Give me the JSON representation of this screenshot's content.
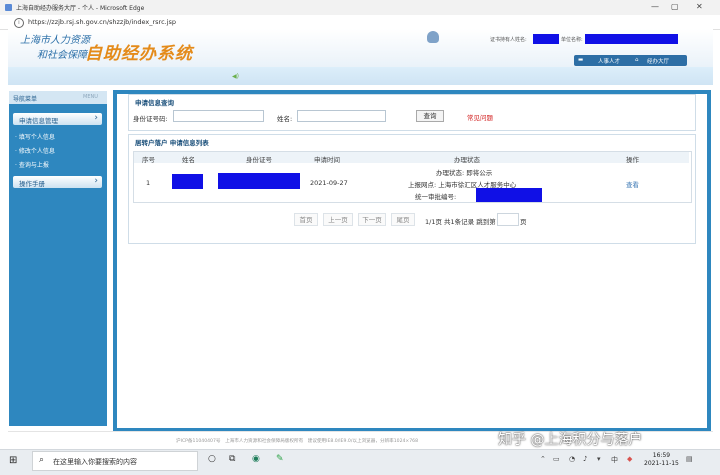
{
  "window": {
    "title": "上海自助经办服务大厅 - 个人 - Microsoft Edge",
    "url": "https://zzjb.rsj.sh.gov.cn/shzzjb/index_rsrc.jsp",
    "controls": [
      "—",
      "▢",
      "✕"
    ]
  },
  "header": {
    "logo_line1": "上海市人力资源",
    "logo_line2": "和社会保障",
    "system_name": "自助经办系统",
    "cert_holder_label": "证书持有人姓名:",
    "unit_name_label": "单位名称:",
    "nav_left": "人事人才",
    "nav_right": "经办大厅"
  },
  "sidebar": {
    "title": "导航菜单",
    "title_en": "MENU",
    "groups": [
      {
        "label": "申请信息管理",
        "items": [
          "填写个人信息",
          "修改个人信息",
          "查询与上报"
        ]
      },
      {
        "label": "操作手册",
        "items": []
      }
    ]
  },
  "query": {
    "section_title": "申请信息查询",
    "id_label": "身份证号码:",
    "name_label": "姓名:",
    "query_button": "查询",
    "faq_link": "常见问题"
  },
  "list": {
    "section_title": "居转户落户 申请信息列表",
    "columns": [
      "序号",
      "姓名",
      "身份证号",
      "申请时间",
      "办理状态",
      "操作"
    ],
    "rows": [
      {
        "index": "1",
        "apply_time": "2021-09-27",
        "status_line1": "办理状态: 即将公示",
        "status_line2": "上报网点: 上海市徐汇区人才服务中心",
        "status_line3": "统一审批编号:",
        "action": "查看"
      }
    ]
  },
  "pagination": {
    "first": "首页",
    "prev": "上一页",
    "next": "下一页",
    "last": "尾页",
    "info": "1/1页 共1条记录 跳到第",
    "unit": "页"
  },
  "footer": {
    "text": "沪ICP备11040407号　上海市人力资源和社会保障局版权所有　建议使用IE8.0/IE9.0/以上浏览器，分辨率1024×768"
  },
  "watermark": "知乎 @上海积分与落户",
  "taskbar": {
    "search_placeholder": "在这里输入你要搜索的内容",
    "time": "16:59",
    "date": "2021-11-15"
  },
  "colors": {
    "sidebar_blue": "#2e87bf",
    "logo_orange": "#e48b1a",
    "redaction_blue": "#1010e6",
    "faq_red": "#d21f1f"
  }
}
